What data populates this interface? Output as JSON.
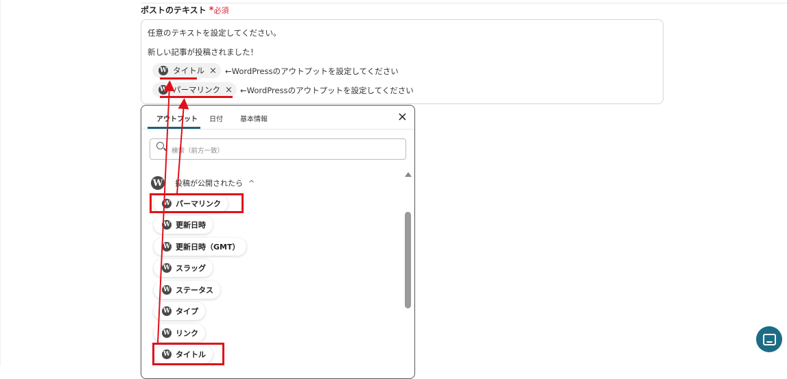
{
  "field": {
    "label": "ポストのテキスト",
    "required_star": "*",
    "required_text": "必須"
  },
  "textarea": {
    "line1": "任意のテキストを設定してください。",
    "line2": "新しい記事が投稿されました！",
    "chips": [
      {
        "label": "タイトル",
        "remove": "×",
        "hint": "←WordPressのアウトプットを設定してください"
      },
      {
        "label": "パーマリンク",
        "remove": "×",
        "hint": "←WordPressのアウトプットを設定してください"
      }
    ]
  },
  "panel": {
    "tabs": [
      "アウトプット",
      "日付",
      "基本情報"
    ],
    "close": "×",
    "search_placeholder": "検索（前方一致）",
    "group_title": "投稿が公開されたら",
    "group_chevron": "^",
    "items": [
      {
        "label": "パーマリンク"
      },
      {
        "label": "更新日時"
      },
      {
        "label": "更新日時（GMT）"
      },
      {
        "label": "スラッグ"
      },
      {
        "label": "ステータス"
      },
      {
        "label": "タイプ"
      },
      {
        "label": "リンク"
      },
      {
        "label": "タイトル"
      }
    ]
  },
  "icons": {
    "wordpress": "W"
  },
  "colors": {
    "required": "#e0263a",
    "annotation": "#e0101a",
    "accent": "#1f5f7a",
    "chat": "#1d6c86"
  }
}
